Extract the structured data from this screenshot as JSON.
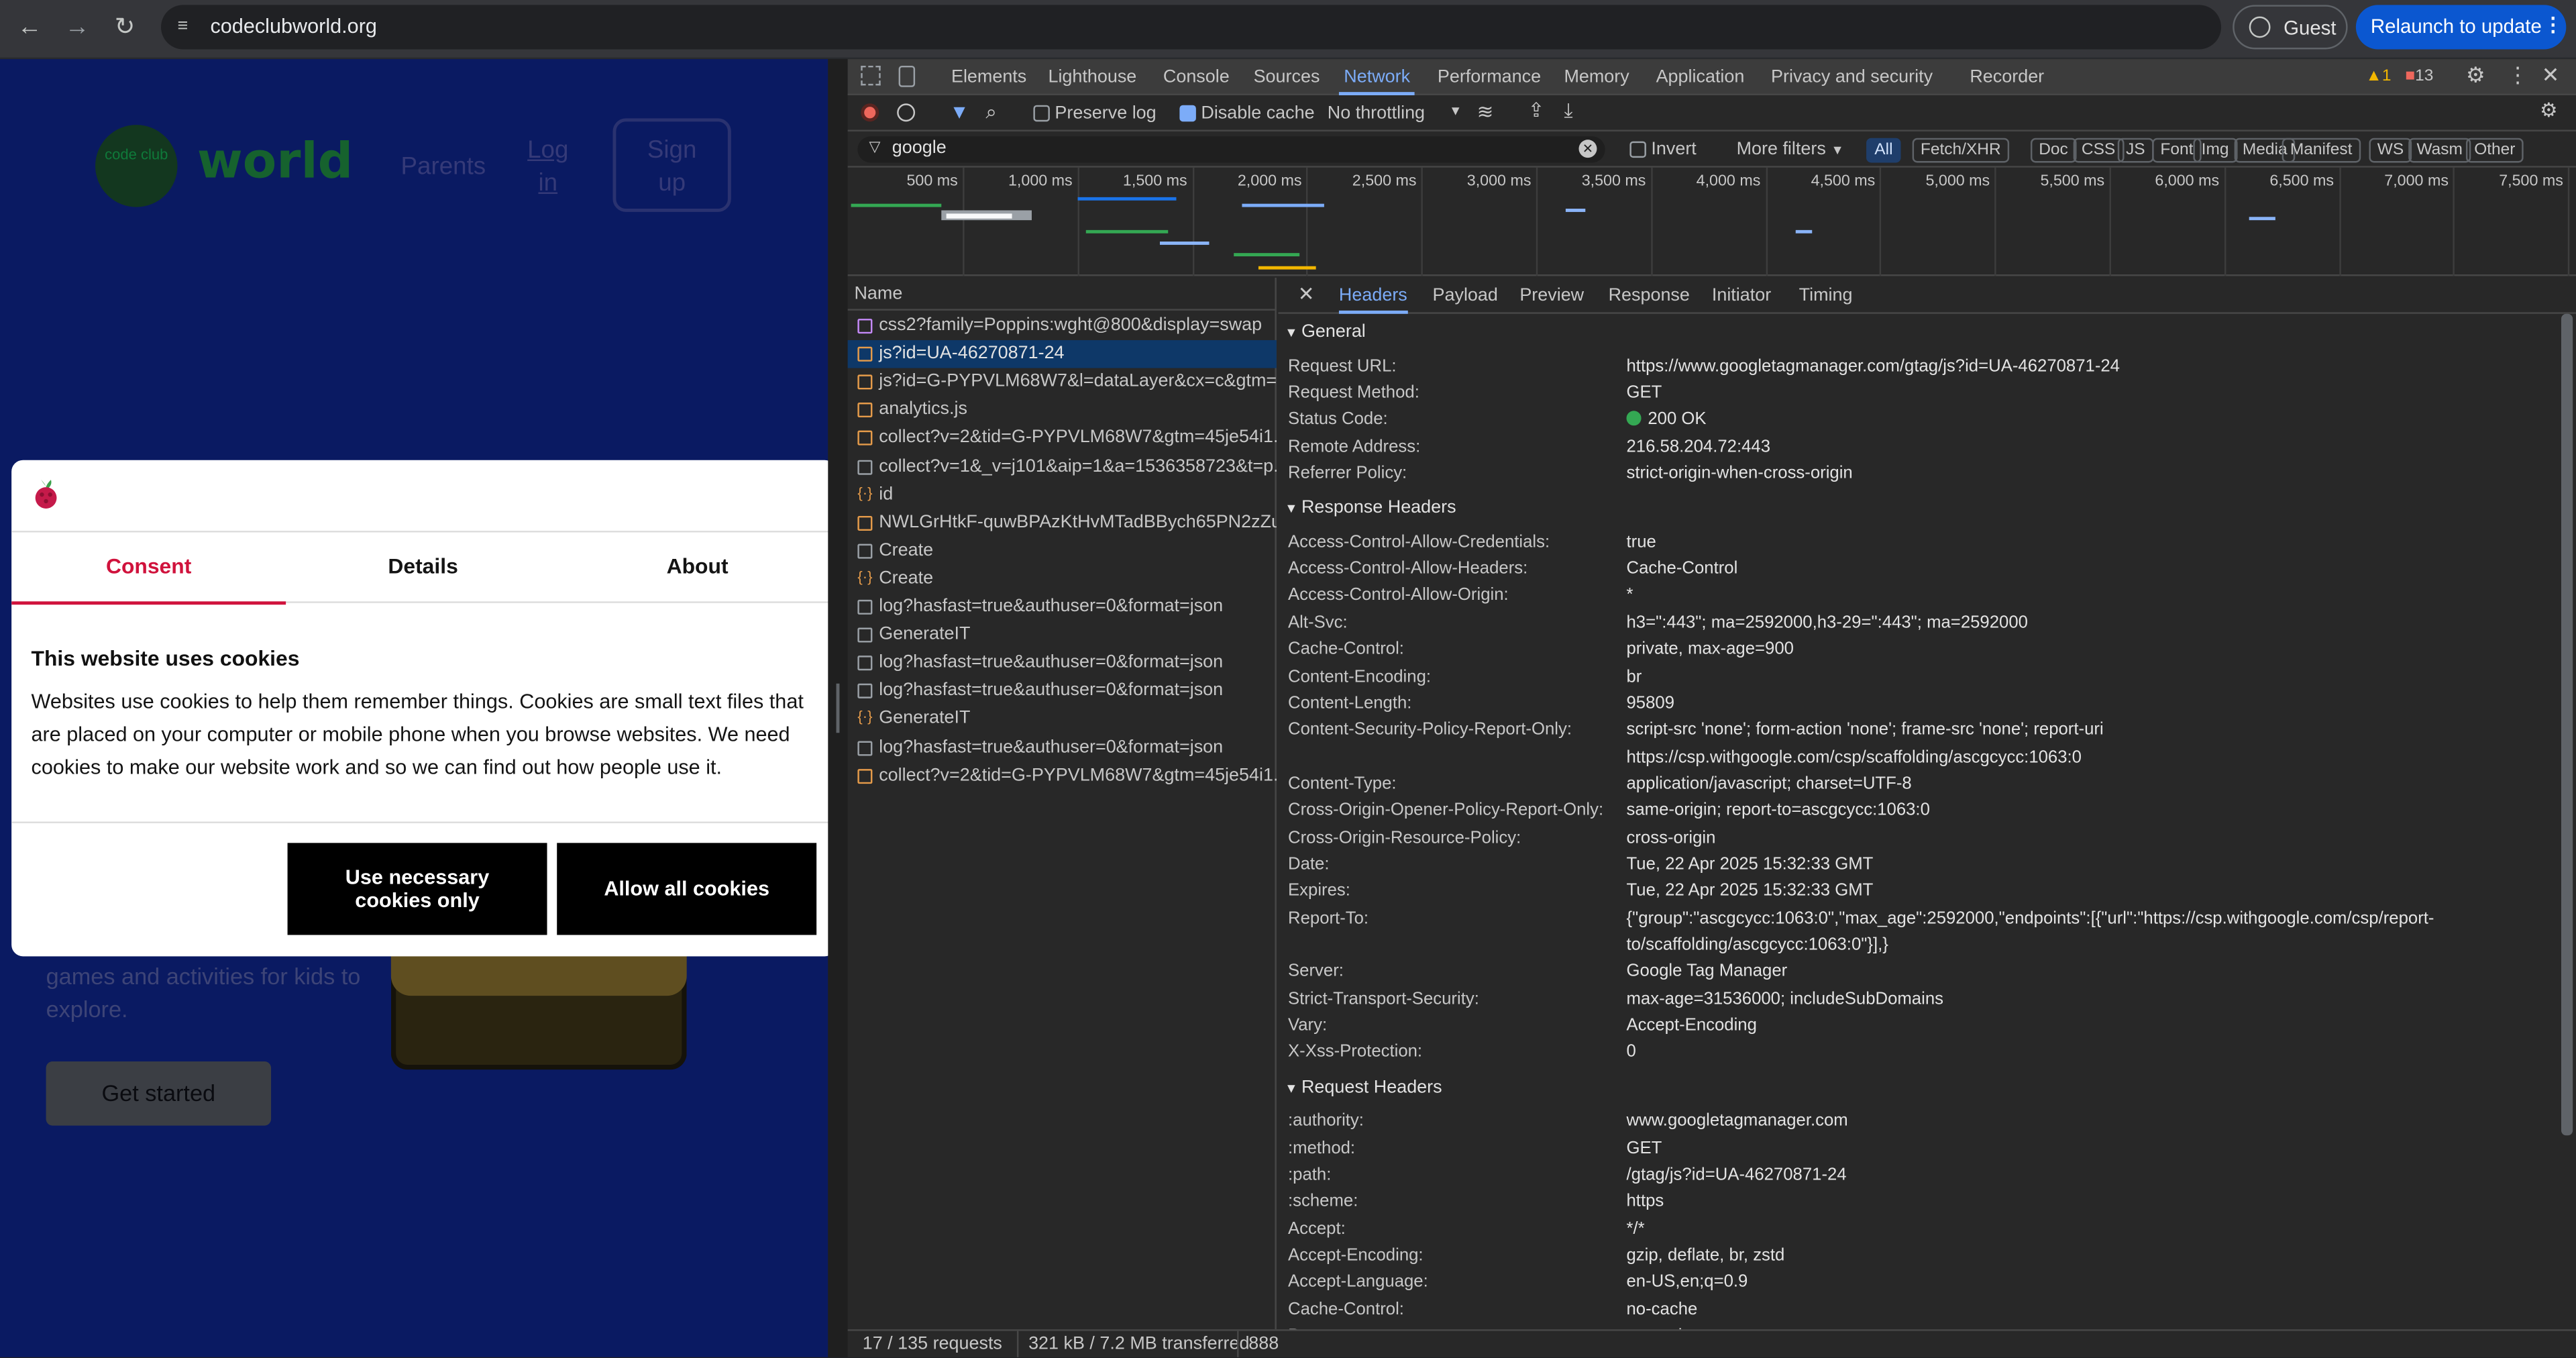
{
  "browser": {
    "url": "codeclubworld.org",
    "guest_label": "Guest",
    "relaunch_label": "Relaunch to update",
    "back": "←",
    "forward": "→",
    "reload": "↻",
    "menu": "⋮",
    "site_info": "≡"
  },
  "page": {
    "logo_text": "code club",
    "logo_word": "world",
    "nav_parents": "Parents",
    "nav_login_1": "Log",
    "nav_login_2": "in",
    "nav_signup_1": "Sign",
    "nav_signup_2": "up",
    "hero_text": "games and activities for kids to explore.",
    "get_started": "Get started"
  },
  "cookie": {
    "tabs": [
      "Consent",
      "Details",
      "About"
    ],
    "title": "This website uses cookies",
    "body": "Websites use cookies to help them remember things. Cookies are small text files that are placed on your computer or mobile phone when you browse websites. We need cookies to make our website work and so we can find out how people use it.",
    "btn_necessary_1": "Use necessary",
    "btn_necessary_2": "cookies only",
    "btn_allow": "Allow all cookies"
  },
  "devtools": {
    "tabs": [
      "Elements",
      "Lighthouse",
      "Console",
      "Sources",
      "Network",
      "Performance",
      "Memory",
      "Application",
      "Privacy and security",
      "Recorder"
    ],
    "warn_count": "1",
    "issue_count": "13",
    "preserve_log": "Preserve log",
    "disable_cache": "Disable cache",
    "throttling": "No throttling",
    "filter_value": "google",
    "invert": "Invert",
    "more_filters": "More filters",
    "types": [
      "All",
      "Fetch/XHR",
      "Doc",
      "CSS",
      "JS",
      "Font",
      "Img",
      "Media",
      "Manifest",
      "WS",
      "Wasm",
      "Other"
    ],
    "ticks": [
      "500 ms",
      "1,000 ms",
      "1,500 ms",
      "2,000 ms",
      "2,500 ms",
      "3,000 ms",
      "3,500 ms",
      "4,000 ms",
      "4,500 ms",
      "5,000 ms",
      "5,500 ms",
      "6,000 ms",
      "6,500 ms",
      "7,000 ms",
      "7,500 ms"
    ],
    "name_header": "Name",
    "requests": [
      {
        "name": "css2?family=Poppins:wght@800&display=swap",
        "icon": "css"
      },
      {
        "name": "js?id=UA-46270871-24",
        "icon": "js",
        "selected": true
      },
      {
        "name": "js?id=G-PYPVLM68W7&l=dataLayer&cx=c&gtm=...",
        "icon": "js"
      },
      {
        "name": "analytics.js",
        "icon": "js"
      },
      {
        "name": "collect?v=2&tid=G-PYPVLM68W7&gtm=45je54i1...",
        "icon": "js"
      },
      {
        "name": "collect?v=1&_v=j101&aip=1&a=1536358723&t=p...",
        "icon": "doc"
      },
      {
        "name": "id",
        "icon": "ws"
      },
      {
        "name": "NWLGrHtkF-quwBPAzKtHvMTadBBych65PN2zZu...",
        "icon": "js"
      },
      {
        "name": "Create",
        "icon": "doc"
      },
      {
        "name": "Create",
        "icon": "ws"
      },
      {
        "name": "log?hasfast=true&authuser=0&format=json",
        "icon": "doc"
      },
      {
        "name": "GenerateIT",
        "icon": "doc"
      },
      {
        "name": "log?hasfast=true&authuser=0&format=json",
        "icon": "doc"
      },
      {
        "name": "log?hasfast=true&authuser=0&format=json",
        "icon": "doc"
      },
      {
        "name": "GenerateIT",
        "icon": "ws"
      },
      {
        "name": "log?hasfast=true&authuser=0&format=json",
        "icon": "doc"
      },
      {
        "name": "collect?v=2&tid=G-PYPVLM68W7&gtm=45je54i1...",
        "icon": "js"
      }
    ],
    "detail_tabs": [
      "Headers",
      "Payload",
      "Preview",
      "Response",
      "Initiator",
      "Timing"
    ],
    "general_title": "General",
    "general": [
      [
        "Request URL:",
        "https://www.googletagmanager.com/gtag/js?id=UA-46270871-24"
      ],
      [
        "Request Method:",
        "GET"
      ],
      [
        "Status Code:",
        "200 OK"
      ],
      [
        "Remote Address:",
        "216.58.204.72:443"
      ],
      [
        "Referrer Policy:",
        "strict-origin-when-cross-origin"
      ]
    ],
    "response_title": "Response Headers",
    "response": [
      [
        "Access-Control-Allow-Credentials:",
        "true"
      ],
      [
        "Access-Control-Allow-Headers:",
        "Cache-Control"
      ],
      [
        "Access-Control-Allow-Origin:",
        "*"
      ],
      [
        "Alt-Svc:",
        "h3=\":443\"; ma=2592000,h3-29=\":443\"; ma=2592000"
      ],
      [
        "Cache-Control:",
        "private, max-age=900"
      ],
      [
        "Content-Encoding:",
        "br"
      ],
      [
        "Content-Length:",
        "95809"
      ],
      [
        "Content-Security-Policy-Report-Only:",
        "script-src 'none'; form-action 'none'; frame-src 'none'; report-uri"
      ],
      [
        "",
        "https://csp.withgoogle.com/csp/scaffolding/ascgcycc:1063:0"
      ],
      [
        "Content-Type:",
        "application/javascript; charset=UTF-8"
      ],
      [
        "Cross-Origin-Opener-Policy-Report-Only:",
        "same-origin; report-to=ascgcycc:1063:0"
      ],
      [
        "Cross-Origin-Resource-Policy:",
        "cross-origin"
      ],
      [
        "Date:",
        "Tue, 22 Apr 2025 15:32:33 GMT"
      ],
      [
        "Expires:",
        "Tue, 22 Apr 2025 15:32:33 GMT"
      ],
      [
        "Report-To:",
        "{\"group\":\"ascgcycc:1063:0\",\"max_age\":2592000,\"endpoints\":[{\"url\":\"https://csp.withgoogle.com/csp/report-"
      ],
      [
        "",
        "to/scaffolding/ascgcycc:1063:0\"}],}"
      ],
      [
        "Server:",
        "Google Tag Manager"
      ],
      [
        "Strict-Transport-Security:",
        "max-age=31536000; includeSubDomains"
      ],
      [
        "Vary:",
        "Accept-Encoding"
      ],
      [
        "X-Xss-Protection:",
        "0"
      ]
    ],
    "request_title": "Request Headers",
    "request": [
      [
        ":authority:",
        "www.googletagmanager.com"
      ],
      [
        ":method:",
        "GET"
      ],
      [
        ":path:",
        "/gtag/js?id=UA-46270871-24"
      ],
      [
        ":scheme:",
        "https"
      ],
      [
        "Accept:",
        "*/*"
      ],
      [
        "Accept-Encoding:",
        "gzip, deflate, br, zstd"
      ],
      [
        "Accept-Language:",
        "en-US,en;q=0.9"
      ],
      [
        "Cache-Control:",
        "no-cache"
      ],
      [
        "Pragma:",
        "no-cache"
      ]
    ],
    "status_requests": "17 / 135 requests",
    "status_transferred": "321 kB / 7.2 MB transferred",
    "status_more": "888"
  },
  "colors": {
    "accent": "#7cacf8",
    "status_ok": "#34a853",
    "cookie_accent": "#d0123c",
    "relaunch": "#0b57d0"
  }
}
